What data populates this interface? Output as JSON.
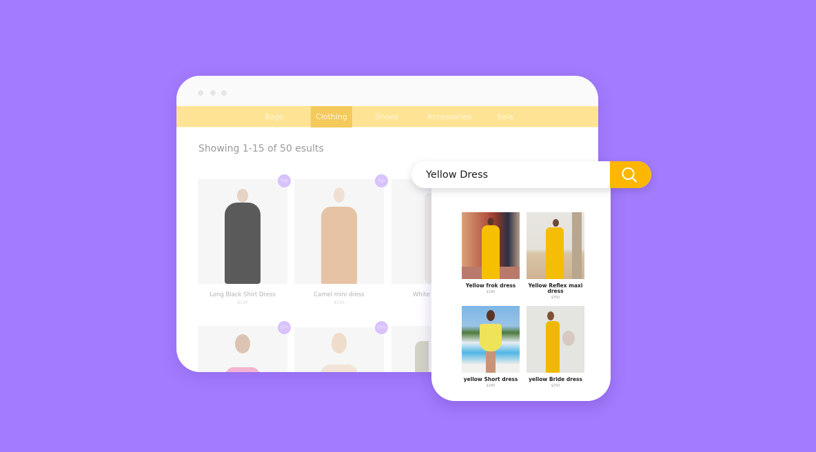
{
  "window": {
    "nav": {
      "items": [
        {
          "label": "Bags",
          "active": false
        },
        {
          "label": "Clothing",
          "active": true
        },
        {
          "label": "Shoes",
          "active": false
        },
        {
          "label": "Accessories",
          "active": false
        },
        {
          "label": "Sale",
          "active": false
        }
      ]
    },
    "results_text": "Showing 1-15 of 50 esults",
    "products": [
      {
        "name": "Long Black Shirt Dress",
        "price": "$130",
        "badge": "Top"
      },
      {
        "name": "Camel mini dress",
        "price": "$110",
        "badge": "Top"
      },
      {
        "name": "White l",
        "price": "",
        "badge": ""
      },
      {
        "name": "",
        "price": "",
        "badge": "10%"
      },
      {
        "name": "",
        "price": "",
        "badge": "10%"
      },
      {
        "name": "",
        "price": "",
        "badge": ""
      }
    ]
  },
  "search": {
    "query": "Yellow Dress",
    "button_icon": "search-icon",
    "results": [
      {
        "name": "Yellow frok dress",
        "price": "$190"
      },
      {
        "name": "Yellow Reflex maxi dress",
        "price": "$350"
      },
      {
        "name": "yellow Short dress",
        "price": "$180"
      },
      {
        "name": "yellow Bride dress",
        "price": "$250"
      }
    ]
  },
  "colors": {
    "background": "#a37bfd",
    "nav_bar": "#ffe394",
    "nav_active": "#f4ca5c",
    "search_button": "#fdb703",
    "badge": "#d8c2fb"
  }
}
